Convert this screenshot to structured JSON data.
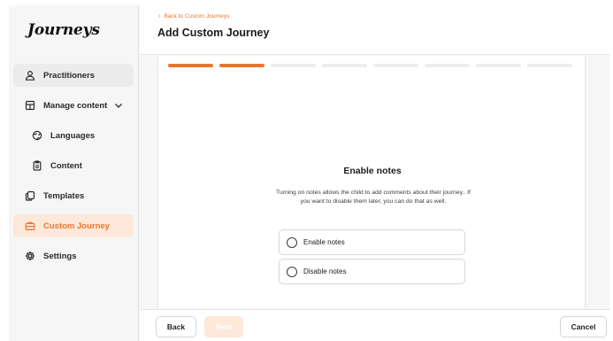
{
  "app": {
    "logo_text": "Journeys"
  },
  "sidebar": {
    "items": [
      {
        "label": "Practitioners",
        "icon": "user-icon",
        "level": 1
      },
      {
        "label": "Manage content",
        "icon": "content-icon",
        "level": 1,
        "expanded": true
      },
      {
        "label": "Languages",
        "icon": "globe-icon",
        "level": 2
      },
      {
        "label": "Content",
        "icon": "clipboard-icon",
        "level": 2
      },
      {
        "label": "Templates",
        "icon": "templates-icon",
        "level": 1
      },
      {
        "label": "Custom Journey",
        "icon": "briefcase-icon",
        "level": 1,
        "active": true
      },
      {
        "label": "Settings",
        "icon": "gear-icon",
        "level": 1
      }
    ]
  },
  "header": {
    "back_label": "Back to Custom Journeys",
    "title": "Add Custom Journey"
  },
  "progress": {
    "total_steps": 8,
    "completed_steps": 2
  },
  "step": {
    "title": "Enable notes",
    "description": "Turning on notes allows the child to add comments about their journey.. If you want to disable them later, you can do that as well.",
    "options": [
      {
        "label": "Enable notes",
        "selected": false
      },
      {
        "label": "Disable notes",
        "selected": false
      }
    ]
  },
  "footer": {
    "back_label": "Back",
    "next_label": "Next",
    "cancel_label": "Cancel"
  },
  "colors": {
    "accent": "#e8772e",
    "accent_light": "#fde8d9",
    "sidebar_bg": "#f6f6f6"
  }
}
